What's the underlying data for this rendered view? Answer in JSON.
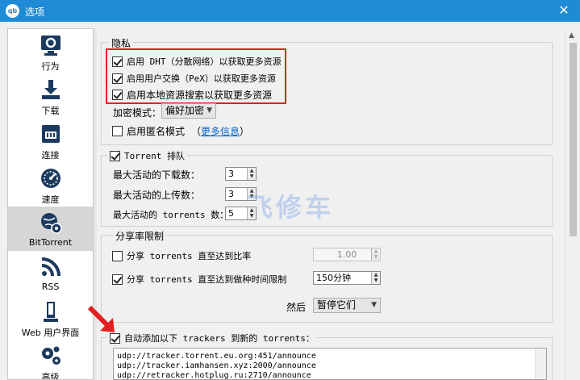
{
  "window": {
    "title": "选项",
    "app_icon_text": "qb",
    "close_glyph": "✕"
  },
  "sidebar": {
    "items": [
      {
        "label": "行为",
        "icon": "gear-monitor-icon"
      },
      {
        "label": "下载",
        "icon": "download-icon"
      },
      {
        "label": "连接",
        "icon": "network-icon"
      },
      {
        "label": "速度",
        "icon": "speedometer-icon"
      },
      {
        "label": "BitTorrent",
        "icon": "globe-gear-icon",
        "active": true
      },
      {
        "label": "RSS",
        "icon": "rss-icon"
      },
      {
        "label": "Web 用户界面",
        "icon": "web-ui-icon"
      },
      {
        "label": "高级",
        "icon": "gears-icon"
      }
    ]
  },
  "privacy": {
    "title": "隐私",
    "dht_label": "启用 DHT（分散网络）以获取更多资源",
    "pex_label": "启用用户交换（PeX）以获取更多资源",
    "lsd_label": "启用本地资源搜索以获取更多资源",
    "encryption_label": "加密模式：",
    "encryption_value": "偏好加密",
    "anonymous_label": "启用匿名模式",
    "more_info": "更多信息",
    "more_info_open": "（",
    "more_info_close": "）"
  },
  "queueing": {
    "title": "Torrent 排队",
    "max_downloads_label": "最大活动的下载数：",
    "max_downloads": "3",
    "max_uploads_label": "最大活动的上传数：",
    "max_uploads": "3",
    "max_torrents_label": "最大活动的 torrents 数：",
    "max_torrents": "5"
  },
  "seeding": {
    "title": "分享率限制",
    "ratio_label": "分享 torrents 直至达到比率",
    "ratio_value": "1.00",
    "time_label": "分享 torrents 直至达到做种时间限制",
    "time_value": "150分钟",
    "then_label": "然后",
    "then_value": "暂停它们"
  },
  "trackers": {
    "label": "自动添加以下 trackers 到新的 torrents：",
    "lines": [
      "udp://tracker.torrent.eu.org:451/announce",
      "udp://tracker.iamhansen.xyz:2000/announce",
      "udp://retracker.hotplug.ru:2710/announce"
    ]
  },
  "watermark": "飞修车",
  "colors": {
    "titlebar": "#1f8ad6",
    "highlight_box": "#e02020",
    "link": "#0066cc"
  }
}
